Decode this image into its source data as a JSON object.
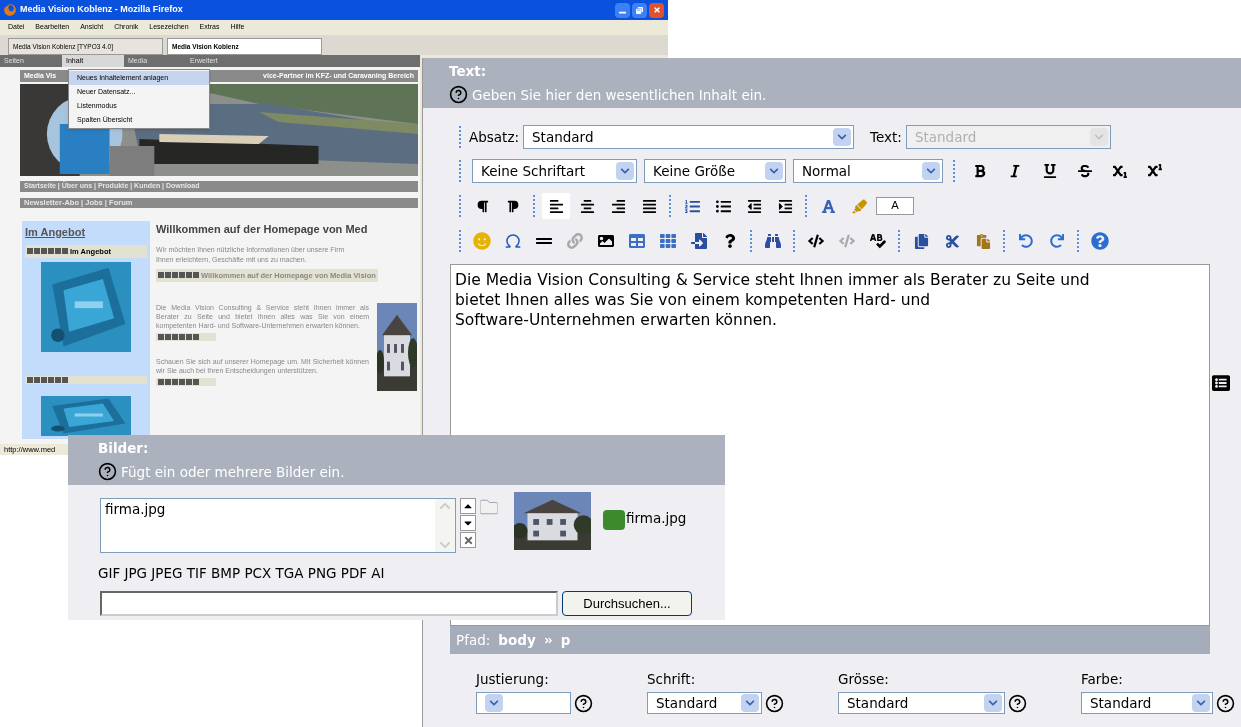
{
  "browser": {
    "title": "Media Vision Koblenz - Mozilla Firefox",
    "menu": [
      "Datei",
      "Bearbeiten",
      "Ansicht",
      "Chronik",
      "Lesezeichen",
      "Extras",
      "Hilfe"
    ],
    "tabs": [
      {
        "label": "Media Vision Koblenz [TYPO3 4.0]",
        "selected": false
      },
      {
        "label": "Media Vision Koblenz",
        "selected": true
      }
    ],
    "typo3_nav": [
      {
        "label": "Seiten",
        "selected": false
      },
      {
        "label": "Inhalt",
        "selected": true
      },
      {
        "label": "Media",
        "selected": false
      },
      {
        "label": "Erweitert",
        "selected": false
      }
    ],
    "dropdown": [
      {
        "label": "Neues Inhaltelement anlagen",
        "selected": true
      },
      {
        "label": "Neuer Datensatz...",
        "selected": false
      },
      {
        "label": "Listenmodus",
        "selected": false
      },
      {
        "label": "Spalten Übersicht",
        "selected": false
      }
    ],
    "site": {
      "header_left": "Media Vis",
      "header_right": "vice-Partner im KFZ- und Caravaning Bereich",
      "nav": "Startseite | Über uns | Produkte | Kunden | Download",
      "subnav": "Newsletter-Abo | Jobs | Forum",
      "sidebar_title": "Im Angebot",
      "sidebar_edit_label": "Im Angebot",
      "heading": "Willkommen auf der Homepage von Med",
      "intro_lines": [
        "Wir möchten Ihnen nützliche Informationen über unsere Firm",
        "Ihnen erleichtern, Geschäfte mit uns zu machen."
      ],
      "intro_edit_label": "Willkommen auf der Homepage von Media Vision",
      "paragraphs": [
        "Die Media Vision Consulting & Service steht Ihnen immer als Berater zu Seite und bietet Ihnen alles was Sie von einem kompetenten Hard- und Software-Unternehmen erwarten können.",
        "Schauen Sie sich auf unserer Homepage um. Mit Sicherheit können wir Sie auch bei Ihren Entscheidungen unterstützen."
      ]
    },
    "status": "http://www.med"
  },
  "text_field": {
    "label": "Text:",
    "help": "Geben Sie hier den wesentlichen Inhalt ein.",
    "block_select": {
      "label": "Absatz:",
      "value": "Standard"
    },
    "style_select": {
      "label": "Text:",
      "value": "Standard",
      "disabled": true
    },
    "font_select": "Keine Schriftart",
    "size_select": "Keine Größe",
    "format_select": "Normal",
    "alignment": [
      {
        "selected": true
      },
      {
        "selected": false
      },
      {
        "selected": false
      },
      {
        "selected": false
      }
    ],
    "color_sample": "A",
    "content_lines": [
      "Die Media Vision Consulting & Service steht Ihnen immer als Berater zu Seite und",
      "bietet Ihnen alles was Sie von einem kompetenten Hard- und",
      "Software-Unternehmen erwarten können."
    ],
    "path_label": "Pfad:",
    "path": [
      "body",
      "p"
    ],
    "options": [
      {
        "label": "Justierung:"
      },
      {
        "label": "Schrift:",
        "value": "Standard"
      },
      {
        "label": "Grösse:",
        "value": "Standard"
      },
      {
        "label": "Farbe:",
        "value": "Standard"
      }
    ]
  },
  "images_field": {
    "label": "Bilder:",
    "help": "Fügt ein oder mehrere Bilder ein.",
    "files": [
      "firma.jpg"
    ],
    "thumbnail_caption": "firma.jpg",
    "allowed_types": "GIF JPG JPEG TIF BMP PCX TGA PNG PDF AI",
    "browse_button": "Durchsuchen..."
  }
}
